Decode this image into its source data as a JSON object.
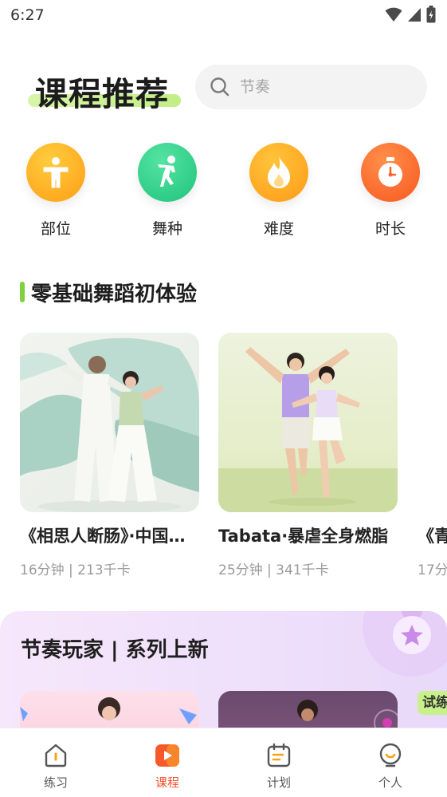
{
  "status_bar": {
    "time": "6:27"
  },
  "header": {
    "title": "课程推荐",
    "search_placeholder": "节奏"
  },
  "categories": [
    {
      "label": "部位",
      "icon": "body-icon",
      "color": "#ffac1c"
    },
    {
      "label": "舞种",
      "icon": "dancer-icon",
      "color": "#2fcf8a"
    },
    {
      "label": "难度",
      "icon": "flame-icon",
      "color": "#ffa31a"
    },
    {
      "label": "时长",
      "icon": "stopwatch-icon",
      "color": "#fd6a2a"
    }
  ],
  "section_beginner": {
    "title": "零基础舞蹈初体验",
    "cards": [
      {
        "title": "《相思人断肠》·中国…",
        "meta": "16分钟 | 213千卡"
      },
      {
        "title": "Tabata·暴虐全身燃脂",
        "meta": "25分钟 | 341千卡"
      },
      {
        "title": "《青",
        "meta": "17分"
      }
    ]
  },
  "section_series": {
    "title": "节奏玩家 | 系列上新",
    "trial_tag": "试练"
  },
  "tab_bar": {
    "tabs": [
      {
        "label": "练习",
        "icon": "home-icon"
      },
      {
        "label": "课程",
        "icon": "play-icon",
        "active": true
      },
      {
        "label": "计划",
        "icon": "calendar-icon"
      },
      {
        "label": "个人",
        "icon": "profile-icon"
      }
    ]
  },
  "colors": {
    "accent": "#f2532b",
    "section_bar": "#7fd23d",
    "highlight": "#c2ee86"
  }
}
